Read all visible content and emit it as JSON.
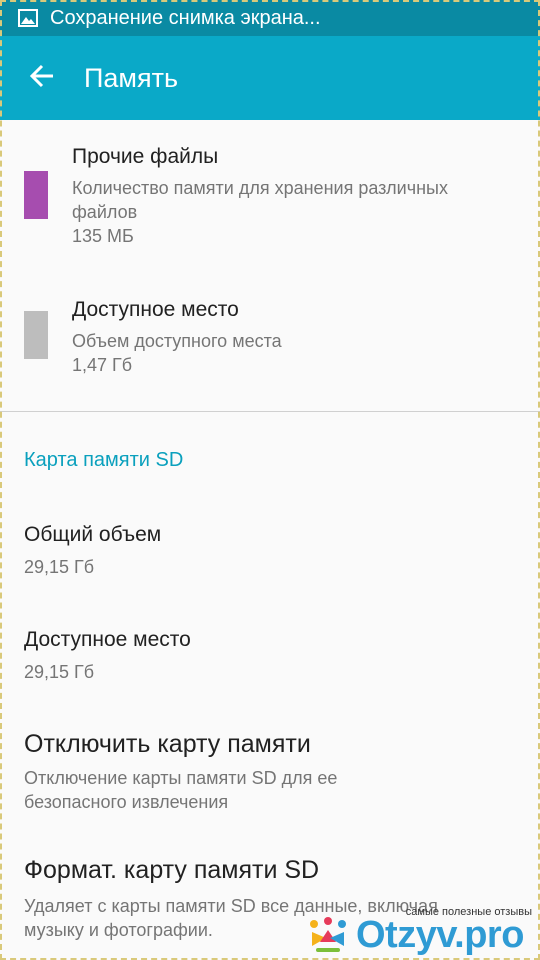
{
  "status_bar": {
    "notification_icon": "image-icon",
    "text": "Сохранение снимка экрана..."
  },
  "app_bar": {
    "back_icon": "arrow-back-icon",
    "title": "Память"
  },
  "internal_storage": [
    {
      "title": "Прочие файлы",
      "desc_line1": "Количество памяти для хранения различных",
      "desc_line2": "файлов",
      "size": "135 МБ",
      "color": "#a64daf"
    },
    {
      "title": "Доступное место",
      "desc_line1": "Объем доступного места",
      "size": "1,47 Гб",
      "color": "#bdbdbd"
    }
  ],
  "sd_card": {
    "header": "Карта памяти SD",
    "total": {
      "title": "Общий объем",
      "value": "29,15 Гб"
    },
    "available": {
      "title": "Доступное место",
      "value": "29,15 Гб"
    },
    "unmount": {
      "title": "Отключить карту памяти",
      "summary_line1": "Отключение карты памяти SD для ее",
      "summary_line2": "безопасного извлечения"
    },
    "format": {
      "title": "Формат. карту памяти SD",
      "summary_line1": "Удаляет с карты памяти SD все данные, включая",
      "summary_line2": "музыку и фотографии."
    }
  },
  "watermark": {
    "tagline": "самые полезные отзывы",
    "brand": "Otzyv.pro"
  },
  "colors": {
    "status_bar": "#0a8aa3",
    "app_bar": "#0aa9c8",
    "accent": "#0aa0bd"
  }
}
